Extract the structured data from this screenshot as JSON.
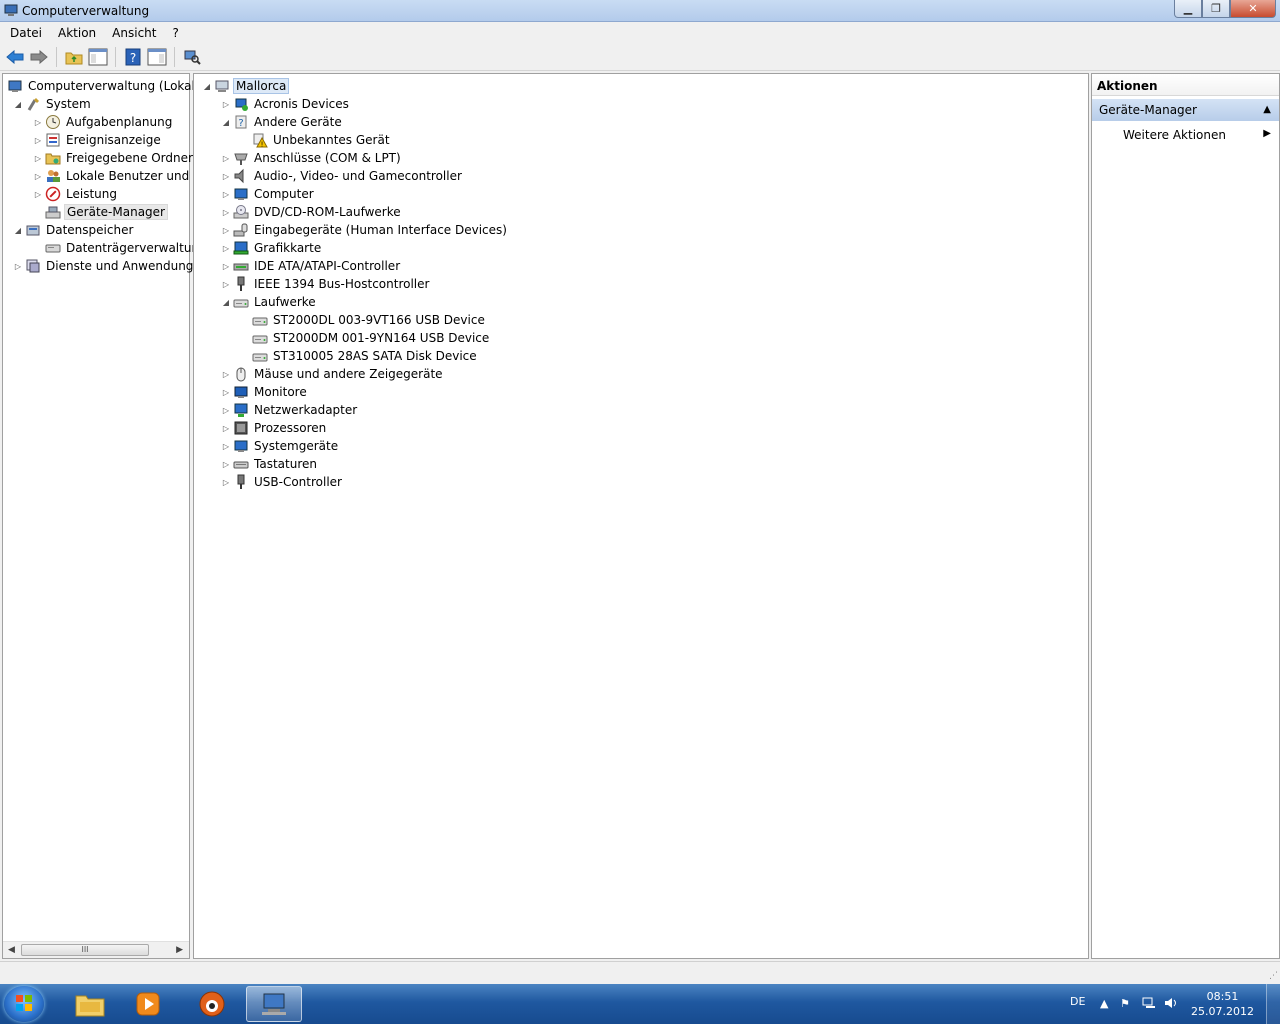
{
  "window": {
    "title": "Computerverwaltung",
    "min_glyph": "▁",
    "max_glyph": "❐",
    "close_glyph": "✕"
  },
  "menu": [
    "Datei",
    "Aktion",
    "Ansicht",
    "?"
  ],
  "toolbar": {
    "icons": [
      "back-arrow-icon",
      "forward-arrow-icon",
      "up-folder-icon",
      "show-hide-console-tree-icon",
      "help-icon",
      "show-hide-action-pane-icon",
      "scan-hardware-icon"
    ]
  },
  "left_tree": [
    {
      "label": "Computerverwaltung (Lokal)",
      "level": 0,
      "expander": "",
      "icon": "computer-management-icon"
    },
    {
      "label": "System",
      "level": 1,
      "expander": "◢",
      "icon": "system-tools-icon"
    },
    {
      "label": "Aufgabenplanung",
      "level": 2,
      "expander": "▷",
      "icon": "task-scheduler-icon"
    },
    {
      "label": "Ereignisanzeige",
      "level": 2,
      "expander": "▷",
      "icon": "event-viewer-icon"
    },
    {
      "label": "Freigegebene Ordner",
      "level": 2,
      "expander": "▷",
      "icon": "shared-folders-icon"
    },
    {
      "label": "Lokale Benutzer und Gr",
      "level": 2,
      "expander": "▷",
      "icon": "local-users-icon"
    },
    {
      "label": "Leistung",
      "level": 2,
      "expander": "▷",
      "icon": "performance-icon"
    },
    {
      "label": "Geräte-Manager",
      "level": 2,
      "expander": "",
      "icon": "device-manager-icon",
      "selected": true
    },
    {
      "label": "Datenspeicher",
      "level": 1,
      "expander": "◢",
      "icon": "storage-icon"
    },
    {
      "label": "Datenträgerverwaltung",
      "level": 2,
      "expander": "",
      "icon": "disk-management-icon"
    },
    {
      "label": "Dienste und Anwendungen",
      "level": 1,
      "expander": "▷",
      "icon": "services-applications-icon"
    }
  ],
  "device_tree": {
    "root": "Mallorca",
    "items": [
      {
        "label": "Acronis Devices",
        "level": 1,
        "expander": "▷",
        "icon": "acronis-device-icon"
      },
      {
        "label": "Andere Geräte",
        "level": 1,
        "expander": "◢",
        "icon": "unknown-device-icon"
      },
      {
        "label": "Unbekanntes Gerät",
        "level": 2,
        "expander": "",
        "icon": "warning-device-icon"
      },
      {
        "label": "Anschlüsse (COM & LPT)",
        "level": 1,
        "expander": "▷",
        "icon": "port-icon"
      },
      {
        "label": "Audio-, Video- und Gamecontroller",
        "level": 1,
        "expander": "▷",
        "icon": "speaker-icon"
      },
      {
        "label": "Computer",
        "level": 1,
        "expander": "▷",
        "icon": "computer-icon"
      },
      {
        "label": "DVD/CD-ROM-Laufwerke",
        "level": 1,
        "expander": "▷",
        "icon": "dvd-drive-icon"
      },
      {
        "label": "Eingabegeräte (Human Interface Devices)",
        "level": 1,
        "expander": "▷",
        "icon": "hid-icon"
      },
      {
        "label": "Grafikkarte",
        "level": 1,
        "expander": "▷",
        "icon": "display-adapter-icon"
      },
      {
        "label": "IDE ATA/ATAPI-Controller",
        "level": 1,
        "expander": "▷",
        "icon": "ide-controller-icon"
      },
      {
        "label": "IEEE 1394 Bus-Hostcontroller",
        "level": 1,
        "expander": "▷",
        "icon": "firewire-icon"
      },
      {
        "label": "Laufwerke",
        "level": 1,
        "expander": "◢",
        "icon": "disk-drive-icon"
      },
      {
        "label": "ST2000DL 003-9VT166 USB Device",
        "level": 2,
        "expander": "",
        "icon": "disk-drive-icon"
      },
      {
        "label": "ST2000DM 001-9YN164 USB Device",
        "level": 2,
        "expander": "",
        "icon": "disk-drive-icon"
      },
      {
        "label": "ST310005 28AS SATA Disk Device",
        "level": 2,
        "expander": "",
        "icon": "disk-drive-icon"
      },
      {
        "label": "Mäuse und andere Zeigegeräte",
        "level": 1,
        "expander": "▷",
        "icon": "mouse-icon"
      },
      {
        "label": "Monitore",
        "level": 1,
        "expander": "▷",
        "icon": "monitor-icon"
      },
      {
        "label": "Netzwerkadapter",
        "level": 1,
        "expander": "▷",
        "icon": "network-adapter-icon"
      },
      {
        "label": "Prozessoren",
        "level": 1,
        "expander": "▷",
        "icon": "processor-icon"
      },
      {
        "label": "Systemgeräte",
        "level": 1,
        "expander": "▷",
        "icon": "system-device-icon"
      },
      {
        "label": "Tastaturen",
        "level": 1,
        "expander": "▷",
        "icon": "keyboard-icon"
      },
      {
        "label": "USB-Controller",
        "level": 1,
        "expander": "▷",
        "icon": "usb-icon"
      }
    ]
  },
  "actions": {
    "header": "Aktionen",
    "section": "Geräte-Manager",
    "section_caret": "▲",
    "item": "Weitere Aktionen",
    "item_arrow": "▶"
  },
  "scrollbar": {
    "left_arrow": "◀",
    "right_arrow": "▶",
    "thumb_grip": "III"
  },
  "taskbar": {
    "language": "DE",
    "time": "08:51",
    "date": "25.07.2012",
    "tray_up": "▲",
    "tray_icons": [
      "action-center-flag-icon",
      "network-icon",
      "volume-icon"
    ]
  },
  "colors": {
    "taskbar": "#1f58a0",
    "selection": "#dde9f7",
    "action_section": "#b7cde9"
  }
}
